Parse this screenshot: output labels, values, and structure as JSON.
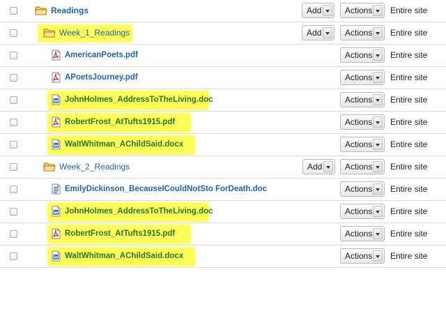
{
  "buttons": {
    "add": "Add",
    "actions": "Actions"
  },
  "rows": [
    {
      "kind": "folder",
      "name": "Readings",
      "scope": "Entire site",
      "has_add": true,
      "highlight": false,
      "level": 0,
      "open": true
    },
    {
      "kind": "folder",
      "name": "Week_1_Readings",
      "scope": "Entire site",
      "has_add": true,
      "highlight": true,
      "level": 1,
      "open": true
    },
    {
      "kind": "file",
      "icon": "pdf-icon",
      "name": "AmericanPoets.pdf",
      "scope": "Entire site",
      "highlight": false
    },
    {
      "kind": "file",
      "icon": "pdf-icon",
      "name": "APoetsJourney.pdf",
      "scope": "Entire site",
      "highlight": false
    },
    {
      "kind": "file",
      "icon": "word-doc-icon",
      "name": "JohnHolmes_AddressToTheLiving.doc",
      "scope": "Entire site",
      "highlight": true
    },
    {
      "kind": "file",
      "icon": "pdf-icon",
      "name": "RobertFrost_AtTufts1915.pdf",
      "scope": "Entire site",
      "highlight": true
    },
    {
      "kind": "file",
      "icon": "word-doc-icon",
      "name": "WaltWhitman_AChildSaid.docx",
      "scope": "Entire site",
      "highlight": true
    },
    {
      "kind": "folder",
      "name": "Week_2_Readings",
      "scope": "Entire site",
      "has_add": true,
      "highlight": false,
      "level": 1,
      "open": true
    },
    {
      "kind": "file",
      "icon": "doc-icon",
      "name": "EmilyDickinson_BecauseICouldNotSto ForDeath.doc",
      "scope": "Entire site",
      "highlight": false
    },
    {
      "kind": "file",
      "icon": "word-doc-icon",
      "name": "JohnHolmes_AddressToTheLiving.doc",
      "scope": "Entire site",
      "highlight": true
    },
    {
      "kind": "file",
      "icon": "pdf-icon",
      "name": "RobertFrost_AtTufts1915.pdf",
      "scope": "Entire site",
      "highlight": true
    },
    {
      "kind": "file",
      "icon": "word-doc-icon",
      "name": "WaltWhitman_AChildSaid.docx",
      "scope": "Entire site",
      "highlight": true
    }
  ],
  "colors": {
    "link": "#1d64b8",
    "highlighted_link": "#207a20",
    "highlight": "#ffff57"
  }
}
